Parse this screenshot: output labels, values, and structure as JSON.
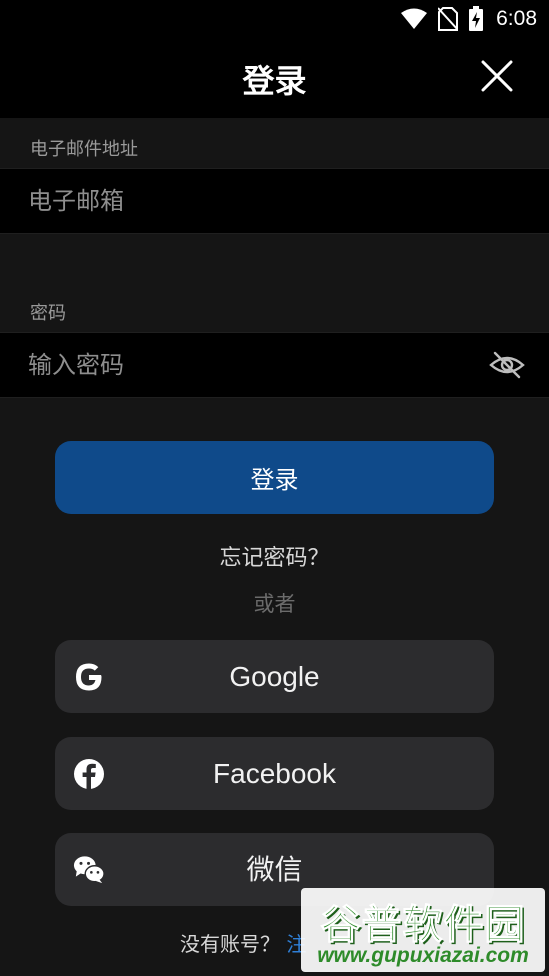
{
  "status_bar": {
    "time": "6:08",
    "icons": [
      "wifi-icon",
      "no-sim-icon",
      "battery-charging-icon"
    ]
  },
  "header": {
    "title": "登录",
    "close_icon": "close-icon"
  },
  "email": {
    "label": "电子邮件地址",
    "placeholder": "电子邮箱",
    "value": ""
  },
  "password": {
    "label": "密码",
    "placeholder": "输入密码",
    "value": "",
    "toggle_icon": "eye-off-icon"
  },
  "login_button": {
    "label": "登录"
  },
  "forgot_password": {
    "label": "忘记密码？"
  },
  "divider": {
    "label": "或者"
  },
  "social": [
    {
      "label": "Google",
      "icon": "google-icon"
    },
    {
      "label": "Facebook",
      "icon": "facebook-icon"
    },
    {
      "label": "微信",
      "icon": "wechat-icon"
    }
  ],
  "signup": {
    "prompt": "没有账号？",
    "link": "注"
  },
  "watermark": {
    "title": "谷普软件园",
    "url": "www.gupuxiazai.com"
  },
  "colors": {
    "background": "#151515",
    "bar": "#000000",
    "primary": "#0f4a8a",
    "social_bg": "#2c2c2e",
    "link": "#2f7fd6",
    "watermark_green": "#2e8b2a"
  }
}
